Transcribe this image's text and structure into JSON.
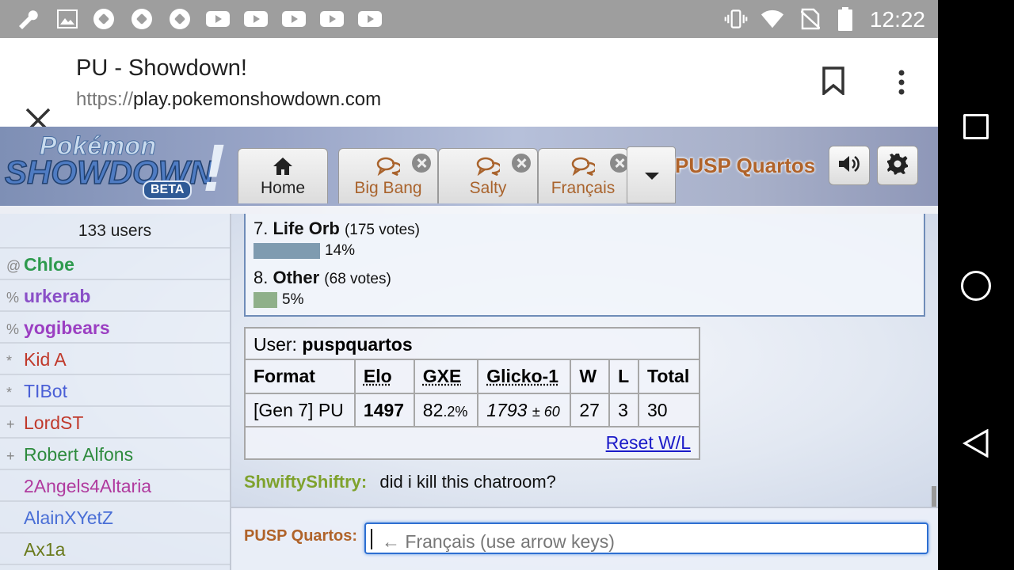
{
  "status_bar": {
    "time": "12:22",
    "left_icons": [
      "wrench-icon",
      "image-icon",
      "soccer-ball-icon",
      "soccer-ball-icon",
      "soccer-ball-icon",
      "youtube-icon",
      "youtube-icon",
      "youtube-icon",
      "youtube-icon",
      "youtube-icon"
    ],
    "right_icons": [
      "vibrate-icon",
      "wifi-icon",
      "no-sim-icon",
      "battery-icon"
    ]
  },
  "browser": {
    "title": "PU - Showdown!",
    "url_scheme": "https://",
    "url_host": "play.pokemonshowdown.com"
  },
  "showdown": {
    "logo_top": "Pokémon",
    "logo_main": "SHOWDOWN",
    "logo_badge": "BETA",
    "logo_bang": "!",
    "tabs": [
      {
        "label": "Home",
        "icon": "home-icon"
      },
      {
        "label": "Big Bang",
        "icon": "chat-bubbles-icon"
      },
      {
        "label": "Salty",
        "icon": "chat-bubbles-icon"
      },
      {
        "label": "Français",
        "icon": "chat-bubbles-icon"
      }
    ],
    "username": "PUSP Quartos"
  },
  "userlist": {
    "count": "133 users",
    "users": [
      {
        "rank": "@",
        "name": "Chloe",
        "color": "#2e9a4e",
        "bold": true
      },
      {
        "rank": "%",
        "name": "urkerab",
        "color": "#8a4fc7",
        "bold": true
      },
      {
        "rank": "%",
        "name": "yogibears",
        "color": "#9b3fc2",
        "bold": true
      },
      {
        "rank": "*",
        "name": "Kid A",
        "color": "#c0392b",
        "bold": false
      },
      {
        "rank": "*",
        "name": "TIBot",
        "color": "#4a5fd6",
        "bold": false
      },
      {
        "rank": "+",
        "name": "LordST",
        "color": "#c0392b",
        "bold": false
      },
      {
        "rank": "+",
        "name": "Robert Alfons",
        "color": "#2e8b3e",
        "bold": false
      },
      {
        "rank": "",
        "name": "2Angels4Altaria",
        "color": "#b03a9e",
        "bold": false
      },
      {
        "rank": "",
        "name": "AlainXYetZ",
        "color": "#4a6fd6",
        "bold": false
      },
      {
        "rank": "",
        "name": "Ax1a",
        "color": "#6a7a1c",
        "bold": false
      }
    ]
  },
  "poll": {
    "options": [
      {
        "num": "7.",
        "name": "Life Orb",
        "votes": "(175 votes)",
        "pct": "14%",
        "fraction": 0.14,
        "color": "#7f9bb0"
      },
      {
        "num": "8.",
        "name": "Other",
        "votes": "(68 votes)",
        "pct": "5%",
        "fraction": 0.05,
        "color": "#8fb08a"
      }
    ]
  },
  "stats": {
    "user_label": "User:",
    "user_name": "puspquartos",
    "headers": [
      "Format",
      "Elo",
      "GXE",
      "Glicko-1",
      "W",
      "L",
      "Total"
    ],
    "row": {
      "format": "[Gen 7] PU",
      "elo": "1497",
      "gxe_main": "82",
      "gxe_dec": ".2%",
      "glicko": "1793",
      "glicko_dev": "± 60",
      "w": "27",
      "l": "3",
      "total": "30"
    },
    "reset_label": "Reset W/L"
  },
  "chat": {
    "speaker": "ShwiftyShiftry:",
    "message": "did i kill this chatroom?"
  },
  "composer": {
    "name": "PUSP Quartos:",
    "placeholder": "← Français (use arrow keys)"
  }
}
